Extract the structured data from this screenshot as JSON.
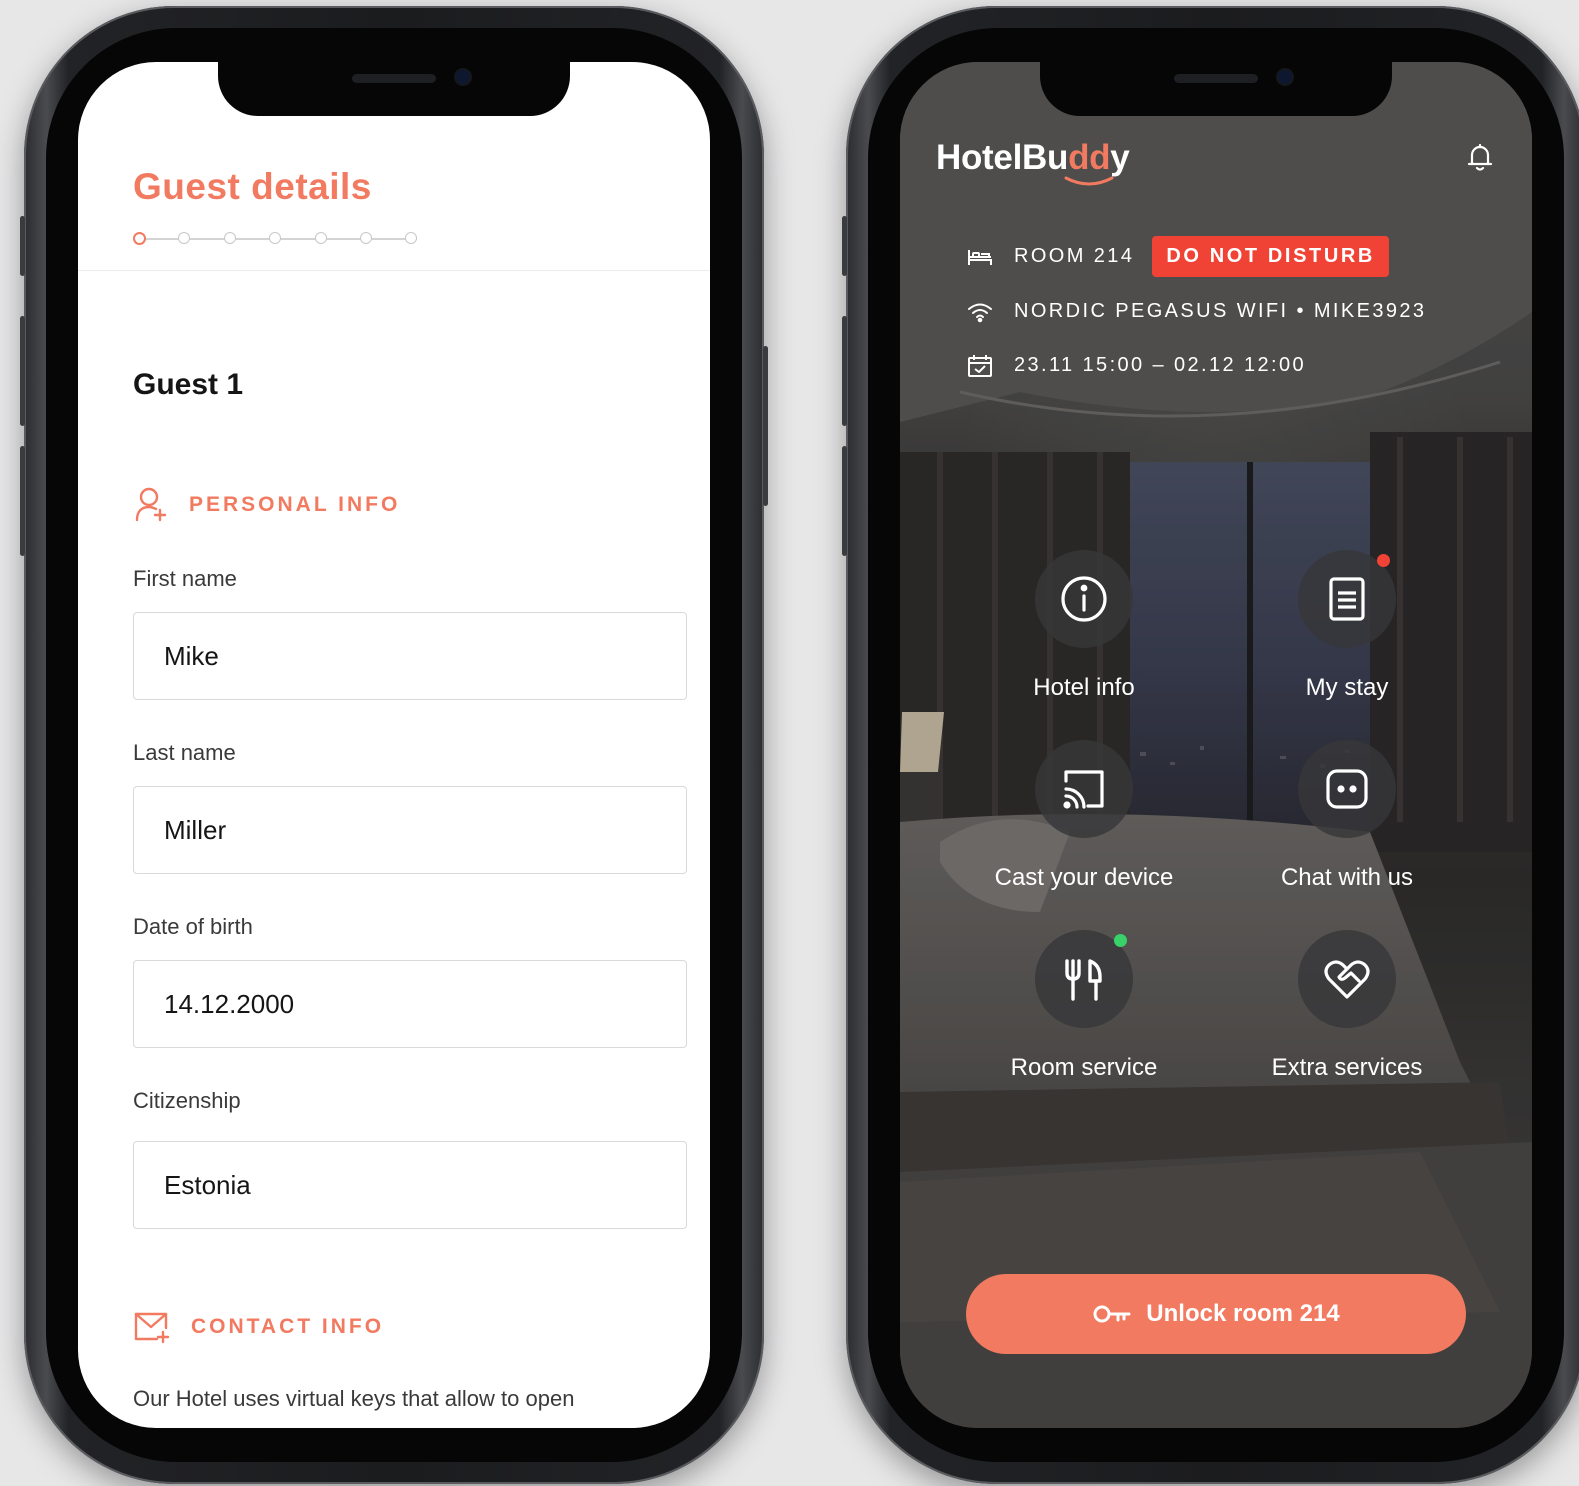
{
  "guest_form": {
    "title": "Guest details",
    "steps_total": 7,
    "active_step": 1,
    "guest_heading": "Guest 1",
    "personal_section": "PERSONAL INFO",
    "fields": [
      {
        "label": "First name",
        "value": "Mike"
      },
      {
        "label": "Last name",
        "value": "Miller"
      },
      {
        "label": "Date of birth",
        "value": "14.12.2000"
      },
      {
        "label": "Citizenship",
        "value": "Estonia"
      }
    ],
    "contact_section": "CONTACT INFO",
    "note": "Our Hotel uses virtual keys that allow to open"
  },
  "hotel_app": {
    "logo_main": "HotelBu",
    "logo_accent": "dd",
    "logo_end": "y",
    "room": "ROOM 214",
    "dnd_badge": "DO NOT DISTURB",
    "wifi": "NORDIC PEGASUS WIFI • MIKE3923",
    "dates": "23.11 15:00 – 02.12 12:00",
    "tiles": [
      {
        "label": "Hotel info",
        "icon": "info-icon"
      },
      {
        "label": "My stay",
        "icon": "document-icon",
        "notification": true
      },
      {
        "label": "Cast your device",
        "icon": "cast-icon"
      },
      {
        "label": "Chat with us",
        "icon": "chat-icon"
      },
      {
        "label": "Room service",
        "icon": "cutlery-icon",
        "status": "online"
      },
      {
        "label": "Extra services",
        "icon": "heart-handshake-icon"
      }
    ],
    "unlock_label": "Unlock room 214"
  },
  "colors": {
    "accent": "#f27a60",
    "dnd_red": "#f04335",
    "notification_red": "#f04335",
    "status_green": "#38d16a"
  }
}
